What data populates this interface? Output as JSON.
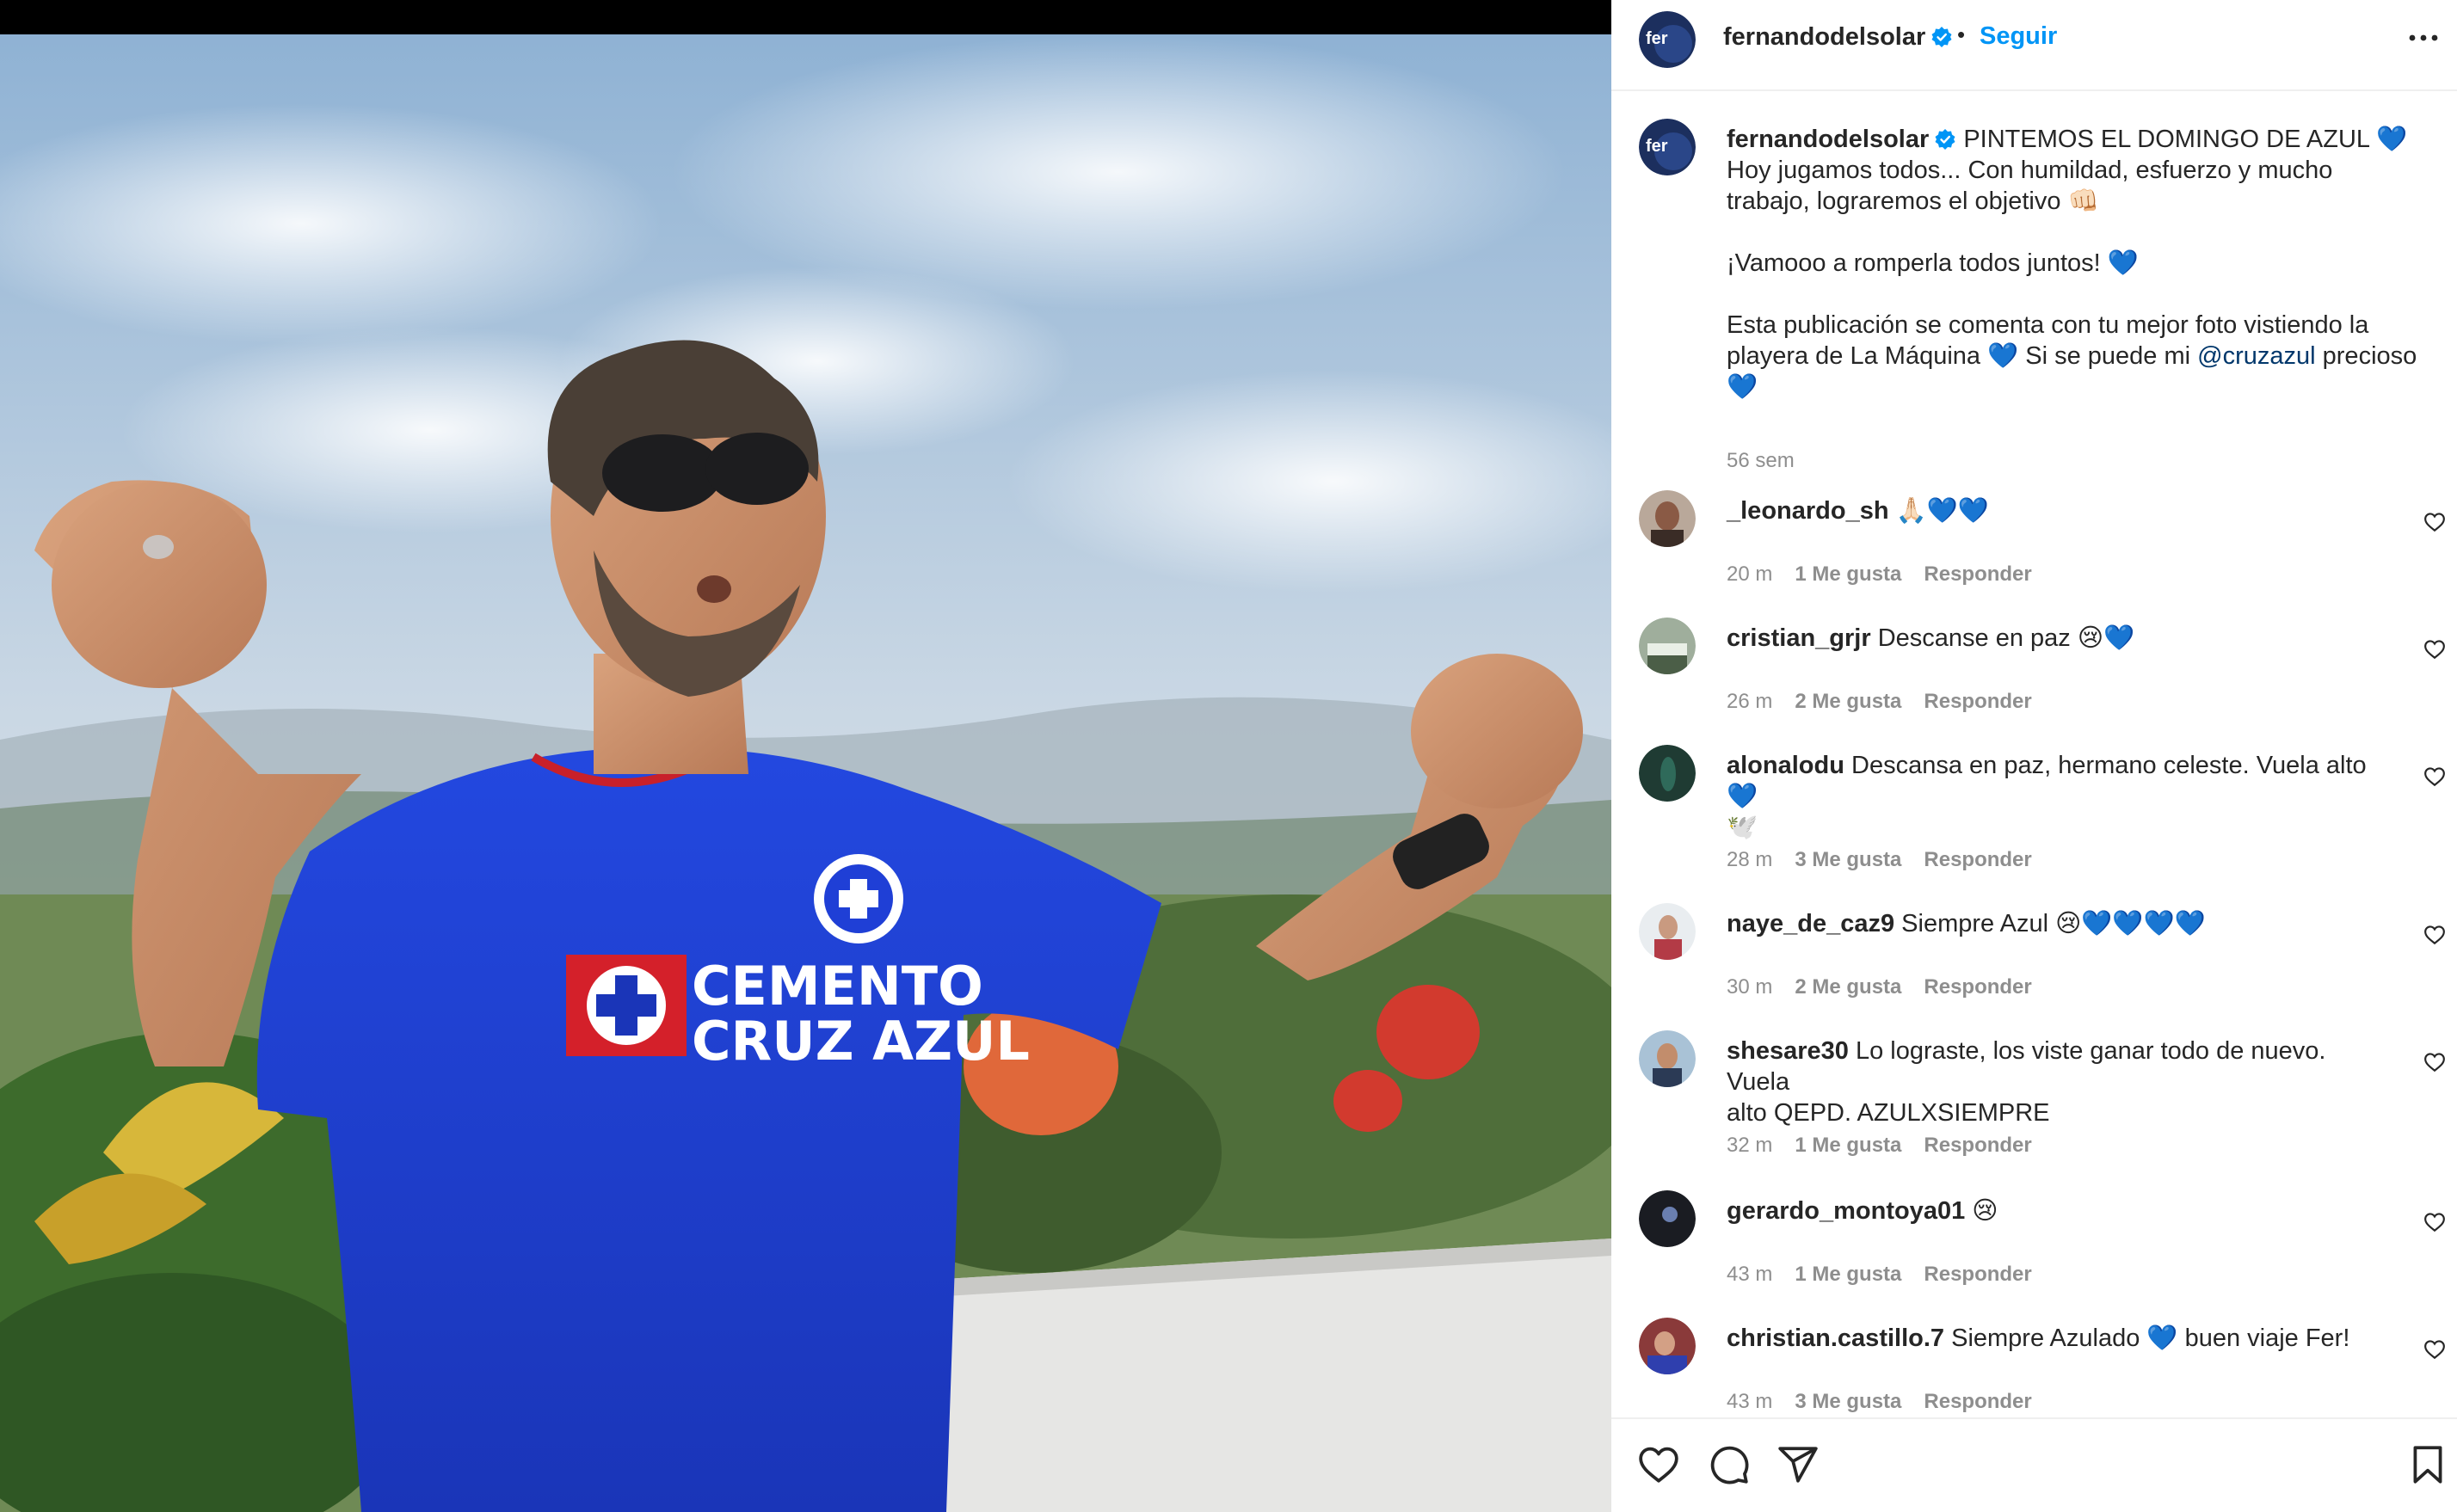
{
  "post": {
    "username": "fernandodelsolar",
    "avatar_text": "fer",
    "follow_label": "Seguir",
    "separator": "•",
    "caption": {
      "line1": "PINTEMOS EL DOMINGO DE AZUL 💙",
      "line2": "Hoy jugamos todos... Con humildad, esfuerzo y mucho",
      "line3": "trabajo, lograremos el objetivo 👊🏻",
      "line4": "¡Vamooo a romperla todos juntos! 💙",
      "line5": "Esta publicación se comenta con tu mejor foto vistiendo la",
      "line6_a": "playera de La Máquina 💙 Si se puede mi ",
      "mention": "@cruzazul",
      "line6_b": " precioso",
      "line7": "💙"
    },
    "time": "56 sem"
  },
  "comments": [
    {
      "user": "_leonardo_sh",
      "text": "🙏🏻💙💙",
      "time": "20 m",
      "likes": "1 Me gusta",
      "reply": "Responder"
    },
    {
      "user": "cristian_grjr",
      "text": "Descanse en paz 😢💙",
      "time": "26 m",
      "likes": "2 Me gusta",
      "reply": "Responder"
    },
    {
      "user": "alonalodu",
      "text": "Descansa en paz, hermano celeste. Vuela alto 💙",
      "text2": "🕊️",
      "time": "28 m",
      "likes": "3 Me gusta",
      "reply": "Responder"
    },
    {
      "user": "naye_de_caz9",
      "text": "Siempre Azul 😢💙💙💙💙",
      "time": "30 m",
      "likes": "2 Me gusta",
      "reply": "Responder"
    },
    {
      "user": "shesare30",
      "text": "Lo lograste, los viste ganar todo de nuevo. Vuela",
      "text2": "alto QEPD. AZULXSIEMPRE",
      "time": "32 m",
      "likes": "1 Me gusta",
      "reply": "Responder"
    },
    {
      "user": "gerardo_montoya01",
      "text": "😢",
      "time": "43 m",
      "likes": "1 Me gusta",
      "reply": "Responder"
    },
    {
      "user": "christian.castillo.7",
      "text": "Siempre Azulado 💙 buen viaje Fer!",
      "time": "43 m",
      "likes": "3 Me gusta",
      "reply": "Responder"
    }
  ],
  "photo": {
    "jersey_line1": "CEMENTO",
    "jersey_line2": "CRUZ AZUL"
  },
  "icons": {
    "verified": "verified-badge-icon",
    "more": "more-options-icon",
    "like": "heart-icon",
    "comment": "comment-icon",
    "share": "send-icon",
    "save": "bookmark-icon"
  },
  "colors": {
    "link": "#0095f6",
    "mention": "#00376b",
    "muted": "#8e8e8e",
    "jersey": "#1f3fd6"
  }
}
